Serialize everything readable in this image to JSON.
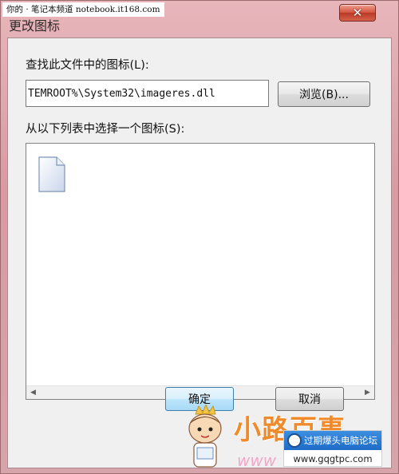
{
  "watermark_top": "你的 · 笔记本频道 notebook.it168.com",
  "window": {
    "title": "更改图标",
    "close_glyph": "✕"
  },
  "dialog": {
    "file_label": "查找此文件中的图标(L):",
    "file_path": "TEMROOT%\\System32\\imageres.dll",
    "browse_label": "浏览(B)...",
    "list_label": "从以下列表中选择一个图标(S):",
    "icons": [
      {
        "name": "blank-document-icon",
        "selected": false
      }
    ],
    "scroll_left": "◀",
    "scroll_right": "▶",
    "ok_label": "确定",
    "cancel_label": "取消"
  },
  "overlay_watermark": {
    "brand": "小路百事",
    "url_partial": "www",
    "badge_name": "过期爆头电脑论坛",
    "badge_url": "www.gqgtpc.com"
  },
  "colors": {
    "frame": "#d99aa2",
    "close_button": "#c94a36",
    "ok_button_border": "#3c7fb1",
    "brand_orange": "#f08a2a"
  }
}
